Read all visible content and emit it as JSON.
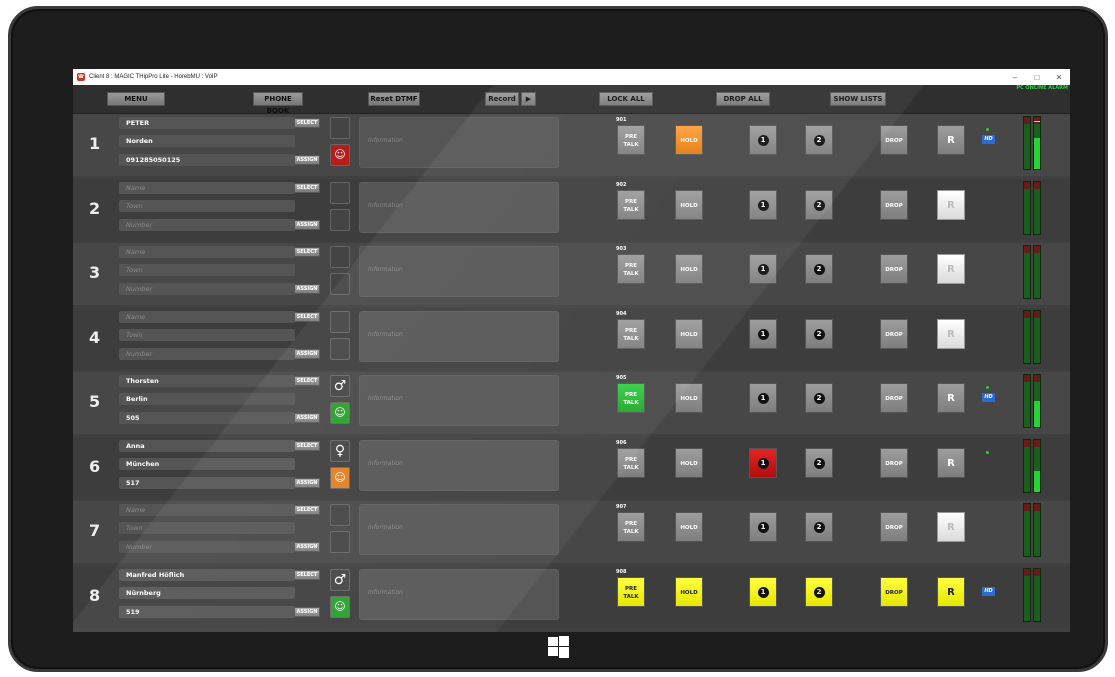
{
  "window": {
    "title": "Client 8 : MAGIC THipPro Lite - HorebMU : VoIP",
    "minimize": "–",
    "maximize": "□",
    "close": "✕"
  },
  "toolbar": {
    "menu": "MENU",
    "phone_book": "PHONE BOOK",
    "reset_dtmf": "Reset DTMF",
    "record": "Record",
    "lock_all": "LOCK ALL",
    "drop_all": "DROP ALL",
    "show_lists": "SHOW LISTS",
    "status": "PC ONLINE  ALARM"
  },
  "labels": {
    "select": "SELECT",
    "assign": "ASSIGN",
    "information": "Information",
    "pre_talk": "PRE\nTALK",
    "hold": "HOLD",
    "drop": "DROP",
    "r": "R",
    "hd": "HD",
    "placeholder_name": "Name",
    "placeholder_town": "Town",
    "placeholder_number": "Number"
  },
  "colors": {
    "green": "#27b52f",
    "orange": "#f08a1e",
    "red": "#c81818",
    "yellow": "#f2f200",
    "hd_blue": "#2d6bd1"
  },
  "lines": [
    {
      "num": "1",
      "ext": "901",
      "name": "PETER",
      "town": "Norden",
      "number": "091285050125",
      "gender": "",
      "face": "red",
      "pretalk": "gray",
      "hold": "orange",
      "l1": "gray",
      "l2": "gray",
      "drop": "gray",
      "r": "gray",
      "dot": true,
      "hd": true,
      "level_l": 0,
      "level_r": 0.6,
      "peak_r": 0.9
    },
    {
      "num": "2",
      "ext": "902",
      "name": "",
      "town": "",
      "number": "",
      "gender": "",
      "face": "",
      "pretalk": "gray",
      "hold": "gray",
      "l1": "gray",
      "l2": "gray",
      "drop": "gray",
      "r": "white",
      "dot": false,
      "hd": false,
      "level_l": 0,
      "level_r": 0
    },
    {
      "num": "3",
      "ext": "903",
      "name": "",
      "town": "",
      "number": "",
      "gender": "",
      "face": "",
      "pretalk": "gray",
      "hold": "gray",
      "l1": "gray",
      "l2": "gray",
      "drop": "gray",
      "r": "white",
      "dot": false,
      "hd": false,
      "level_l": 0,
      "level_r": 0
    },
    {
      "num": "4",
      "ext": "904",
      "name": "",
      "town": "",
      "number": "",
      "gender": "",
      "face": "",
      "pretalk": "gray",
      "hold": "gray",
      "l1": "gray",
      "l2": "gray",
      "drop": "gray",
      "r": "white",
      "dot": false,
      "hd": false,
      "level_l": 0,
      "level_r": 0
    },
    {
      "num": "5",
      "ext": "905",
      "name": "Thorsten",
      "town": "Berlin",
      "number": "505",
      "gender": "♂",
      "face": "green",
      "pretalk": "green",
      "hold": "gray",
      "l1": "gray",
      "l2": "gray",
      "drop": "gray",
      "r": "gray",
      "dot": true,
      "hd": true,
      "level_l": 0,
      "level_r": 0.5
    },
    {
      "num": "6",
      "ext": "906",
      "name": "Anna",
      "town": "München",
      "number": "517",
      "gender": "♀",
      "face": "orange",
      "pretalk": "gray",
      "hold": "gray",
      "l1": "red",
      "l2": "gray",
      "drop": "gray",
      "r": "gray",
      "dot": true,
      "hd": false,
      "level_l": 0,
      "level_r": 0.4
    },
    {
      "num": "7",
      "ext": "907",
      "name": "",
      "town": "",
      "number": "",
      "gender": "",
      "face": "",
      "pretalk": "gray",
      "hold": "gray",
      "l1": "gray",
      "l2": "gray",
      "drop": "gray",
      "r": "white",
      "dot": false,
      "hd": false,
      "level_l": 0,
      "level_r": 0
    },
    {
      "num": "8",
      "ext": "908",
      "name": "Manfred Höflich",
      "town": "Nürnberg",
      "number": "519",
      "gender": "♂",
      "face": "green",
      "pretalk": "yellow",
      "hold": "yellow",
      "l1": "yellow",
      "l2": "yellow",
      "drop": "yellow",
      "r": "yellow",
      "dot": false,
      "hd": true,
      "level_l": 0,
      "level_r": 0
    }
  ]
}
